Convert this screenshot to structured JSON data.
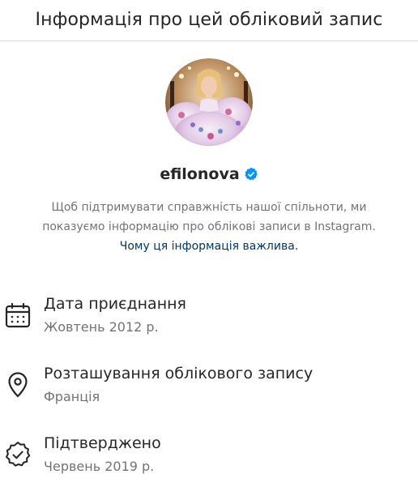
{
  "header": {
    "title": "Інформація про цей обліковий запис"
  },
  "profile": {
    "avatar_icon": "profile-photo",
    "username": "efilonova",
    "verified_icon": "verified-badge-icon",
    "verified_color": "#0095f6"
  },
  "notice": {
    "line1": "Щоб підтримувати справжність нашої спільноти, ми",
    "line2": "показуємо інформацію про облікові записи в Instagram.",
    "link": "Чому ця інформація важлива."
  },
  "info": [
    {
      "icon": "calendar-icon",
      "title": "Дата приєднання",
      "value": "Жовтень 2012 р."
    },
    {
      "icon": "location-pin-icon",
      "title": "Розташування облікового запису",
      "value": "Франція"
    },
    {
      "icon": "verified-check-icon",
      "title": "Підтверджено",
      "value": "Червень 2019 р."
    }
  ],
  "colors": {
    "text_primary": "#262626",
    "text_secondary": "#737373",
    "link": "#00376b",
    "divider": "#dbdbdb"
  }
}
